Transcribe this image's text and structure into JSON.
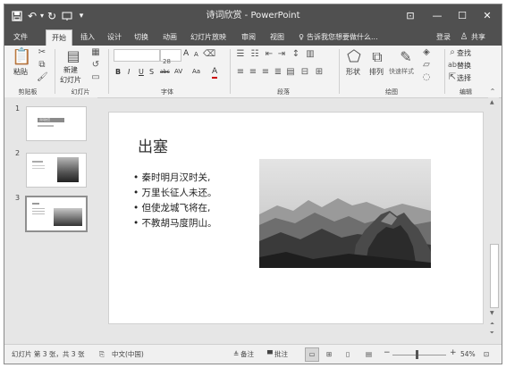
{
  "titlebar": {
    "title": "诗词欣赏 - PowerPoint",
    "save_icon": "save-icon",
    "undo": "↶",
    "redo": "↻",
    "more": "▾",
    "ribbon_display": "⊡",
    "minimize": "—",
    "maximize": "☐",
    "close": "✕"
  },
  "tabs": [
    "文件",
    "开始",
    "插入",
    "设计",
    "切换",
    "动画",
    "幻灯片放映",
    "审阅",
    "视图"
  ],
  "tell_me": "告诉我您想要做什么...",
  "signin": "登录",
  "share": "共享",
  "ribbon": {
    "clipboard": {
      "paste": "粘贴",
      "label": "剪贴板"
    },
    "slides": {
      "new_slide": "新建",
      "new_slide2": "幻灯片",
      "label": "幻灯片"
    },
    "font": {
      "size": "28",
      "grow": "A",
      "shrink": "A",
      "bold": "B",
      "italic": "I",
      "underline": "U",
      "shadow": "S",
      "strike": "abc",
      "spacing": "AV",
      "case": "Aa",
      "color": "A",
      "label": "字体"
    },
    "paragraph": {
      "label": "段落"
    },
    "drawing": {
      "shape": "形状",
      "arrange": "排列",
      "quick_styles": "快速样式",
      "label": "绘图"
    },
    "editing": {
      "find": "查找",
      "replace": "替换",
      "select": "选择",
      "label": "编辑"
    }
  },
  "thumbnails": [
    {
      "num": "1",
      "title": "诗词欣赏"
    },
    {
      "num": "2"
    },
    {
      "num": "3"
    }
  ],
  "slide": {
    "title": "出塞",
    "bullets": [
      "秦时明月汉时关,",
      "万里长征人未还。",
      "但使龙城飞将在,",
      "不教胡马度阴山。"
    ]
  },
  "status": {
    "slide_count": "幻灯片 第 3 张，共 3 张",
    "language": "中文(中国)",
    "notes": "备注",
    "comments": "批注",
    "zoom": "54%",
    "zoom_level": 0.54
  }
}
